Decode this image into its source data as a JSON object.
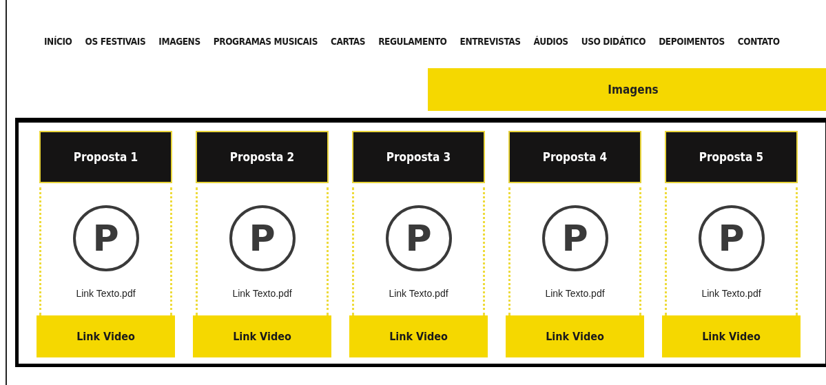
{
  "nav": [
    "INÍCIO",
    "OS FESTIVAIS",
    "IMAGENS",
    "PROGRAMAS MUSICAIS",
    "CARTAS",
    "REGULAMENTO",
    "ENTREVISTAS",
    "ÁUDIOS",
    "USO DIDÁTICO",
    "DEPOIMENTOS",
    "CONTATO"
  ],
  "banner": {
    "title": "Imagens"
  },
  "cards": [
    {
      "title": "Proposta 1",
      "icon_letter": "P",
      "text_link": "Link Texto.pdf",
      "video_link": "Link Video"
    },
    {
      "title": "Proposta 2",
      "icon_letter": "P",
      "text_link": "Link Texto.pdf",
      "video_link": "Link Video"
    },
    {
      "title": "Proposta 3",
      "icon_letter": "P",
      "text_link": "Link Texto.pdf",
      "video_link": "Link Video"
    },
    {
      "title": "Proposta 4",
      "icon_letter": "P",
      "text_link": "Link Texto.pdf",
      "video_link": "Link Video"
    },
    {
      "title": "Proposta 5",
      "icon_letter": "P",
      "text_link": "Link Texto.pdf",
      "video_link": "Link Video"
    }
  ]
}
